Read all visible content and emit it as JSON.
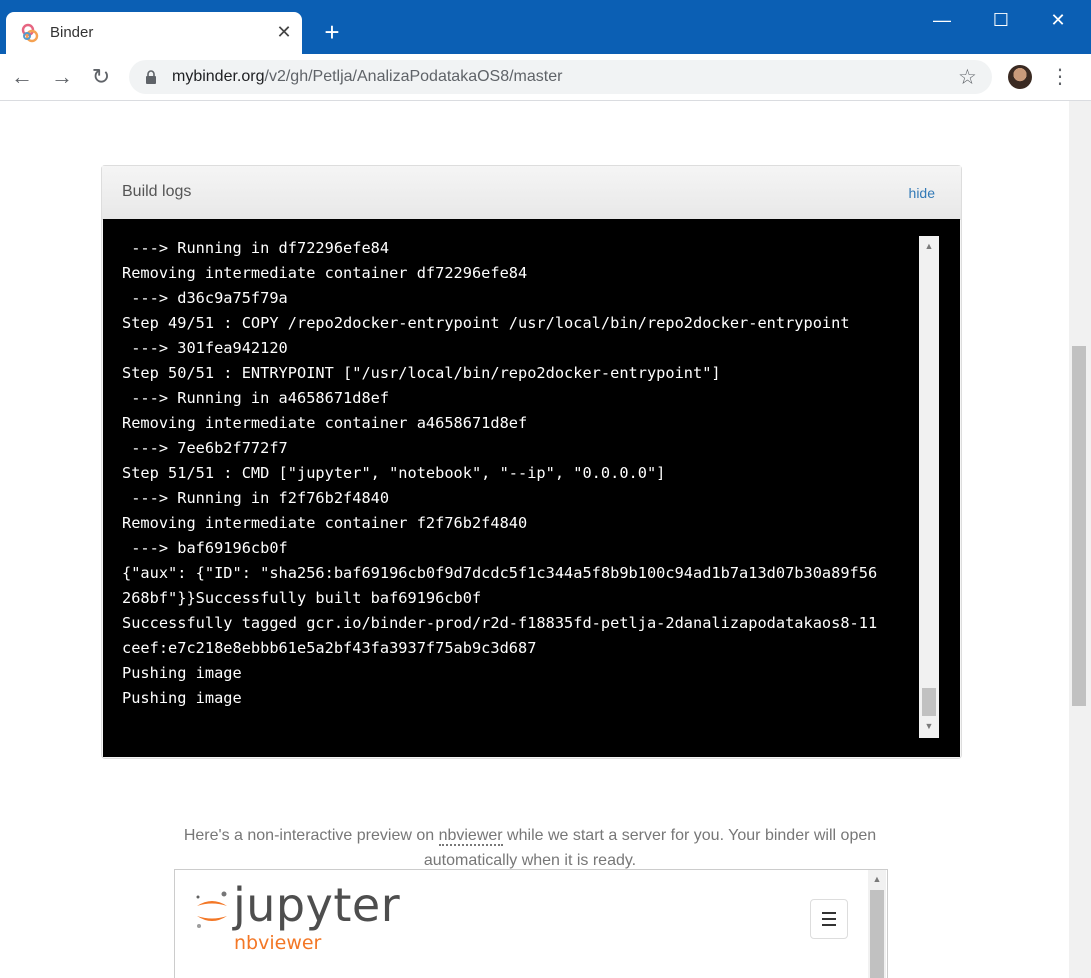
{
  "browser": {
    "tab_title": "Binder",
    "tab_close": "✕",
    "new_tab": "+",
    "window_controls": {
      "minimize": "—",
      "maximize": "☐",
      "close": "✕"
    },
    "nav": {
      "back": "←",
      "forward": "→",
      "reload": "↻"
    },
    "url_host": "mybinder.org",
    "url_path": "/v2/gh/Petlja/AnalizaPodatakaOS8/master",
    "star": "☆",
    "menu": "⋮"
  },
  "logs": {
    "title": "Build logs",
    "hide_label": "hide",
    "lines": [
      " ---> Running in df72296efe84",
      "Removing intermediate container df72296efe84",
      " ---> d36c9a75f79a",
      "Step 49/51 : COPY /repo2docker-entrypoint /usr/local/bin/repo2docker-entrypoint",
      " ---> 301fea942120",
      "Step 50/51 : ENTRYPOINT [\"/usr/local/bin/repo2docker-entrypoint\"]",
      " ---> Running in a4658671d8ef",
      "Removing intermediate container a4658671d8ef",
      " ---> 7ee6b2f772f7",
      "Step 51/51 : CMD [\"jupyter\", \"notebook\", \"--ip\", \"0.0.0.0\"]",
      " ---> Running in f2f76b2f4840",
      "Removing intermediate container f2f76b2f4840",
      " ---> baf69196cb0f",
      "{\"aux\": {\"ID\": \"sha256:baf69196cb0f9d7dcdc5f1c344a5f8b9b100c94ad1b7a13d07b30a89f56",
      "268bf\"}}Successfully built baf69196cb0f",
      "Successfully tagged gcr.io/binder-prod/r2d-f18835fd-petlja-2danalizapodatakaos8-11",
      "ceef:e7c218e8ebbb61e5a2bf43fa3937f75ab9c3d687",
      "Pushing image",
      "Pushing image"
    ]
  },
  "preview": {
    "text_before": "Here's a non-interactive preview on ",
    "link": "nbviewer",
    "text_after": " while we start a server for you. Your binder will open automatically when it is ready."
  },
  "nbviewer": {
    "brand": "jupyter",
    "sub": "nbviewer"
  },
  "colors": {
    "titlebar": "#0b5fb4",
    "terminal_bg": "#000000",
    "link": "#337ab7",
    "jupyter_orange": "#f37726"
  },
  "icons": {
    "favicon": "binder-logo-icon",
    "lock": "lock-icon",
    "star": "star-icon",
    "avatar": "profile-avatar",
    "jupyter": "jupyter-logo-icon",
    "menu": "hamburger-menu-icon"
  }
}
